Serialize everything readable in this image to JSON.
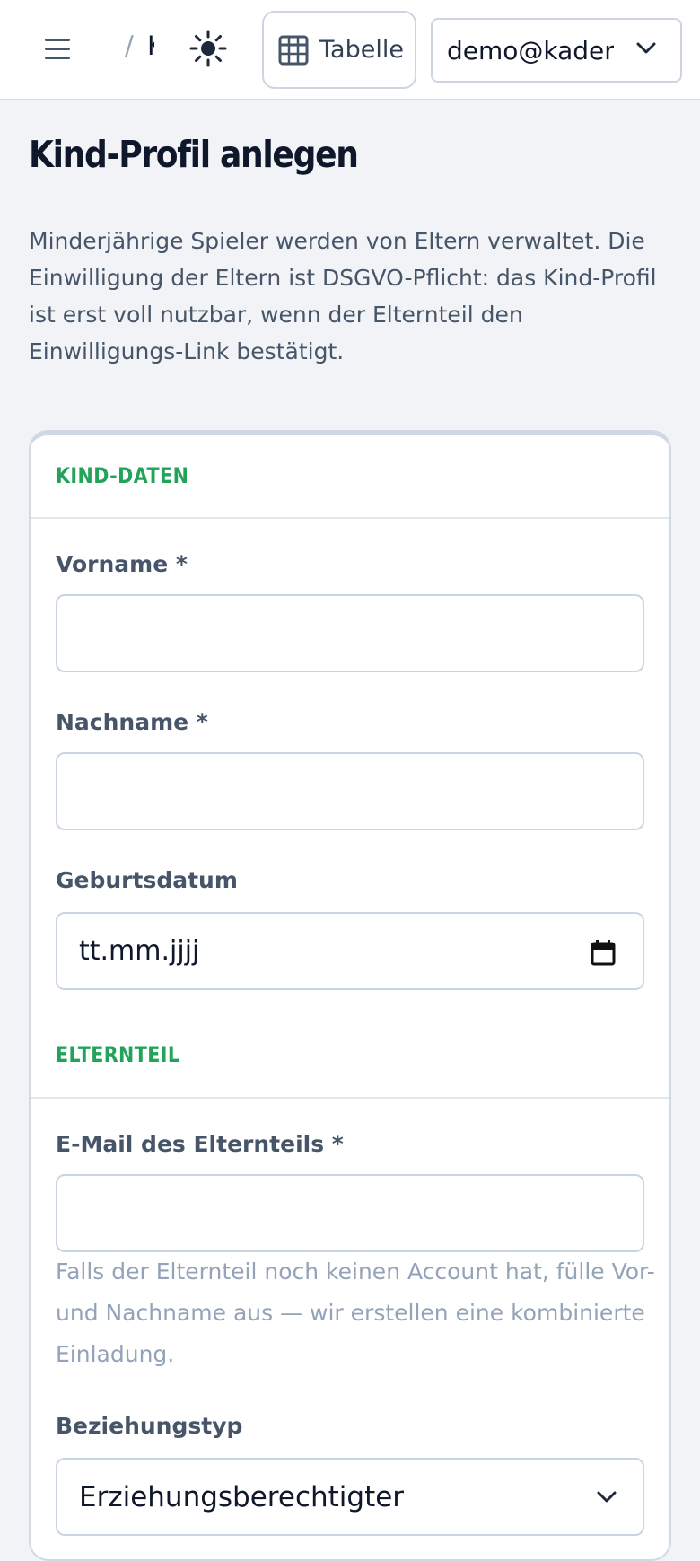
{
  "header": {
    "breadcrumb_separator": "/",
    "breadcrumb_current": "K",
    "table_button_label": "Tabelle",
    "user_email": "demo@kaderhub.de",
    "icons": {
      "menu": "hamburger-menu-icon",
      "theme": "sun-icon",
      "table": "table-grid-icon",
      "dropdown": "chevron-down-icon"
    }
  },
  "page": {
    "title": "Kind-Profil anlegen",
    "intro": "Minderjährige Spieler werden von Eltern verwaltet. Die Einwilligung der Eltern ist DSGVO-Pflicht: das Kind-Profil ist erst voll nutzbar, wenn der Elternteil den Einwilligungs-Link bestätigt."
  },
  "form": {
    "child_section_title": "KIND-DATEN",
    "first_name_label": "Vorname *",
    "first_name_value": "",
    "last_name_label": "Nachname *",
    "last_name_value": "",
    "birthdate_label": "Geburtsdatum",
    "birthdate_placeholder": "tt.mm.jjjj",
    "parent_section_title": "ELTERNTEIL",
    "parent_email_label": "E-Mail des Elternteils *",
    "parent_email_value": "",
    "parent_email_hint": "Falls der Elternteil noch keinen Account hat, fülle Vor- und Nachname aus — wir erstellen eine kombinierte Einladung.",
    "relationship_label": "Beziehungstyp",
    "relationship_value": "Erziehungsberechtigter"
  },
  "colors": {
    "accent_green": "#23a35a",
    "text_dark": "#0f172a",
    "text_muted": "#475569",
    "hint_gray": "#94a3b8",
    "border": "#cbd5e1"
  }
}
